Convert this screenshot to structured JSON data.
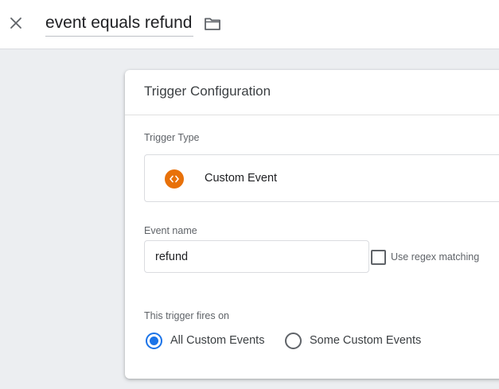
{
  "topbar": {
    "close_icon": "close-icon",
    "title": "event equals refund",
    "folder_icon": "folder-icon"
  },
  "card": {
    "title": "Trigger Configuration",
    "trigger_type": {
      "label": "Trigger Type",
      "value": "Custom Event",
      "icon": "custom-event-icon",
      "icon_color": "#e8710a"
    },
    "event_name": {
      "label": "Event name",
      "value": "refund",
      "regex_label": "Use regex matching",
      "regex_checked": false
    },
    "fires_on": {
      "label": "This trigger fires on",
      "options": [
        {
          "label": "All Custom Events",
          "checked": true
        },
        {
          "label": "Some Custom Events",
          "checked": false
        }
      ]
    }
  },
  "colors": {
    "accent": "#1a73e8",
    "background": "#eceef1"
  }
}
